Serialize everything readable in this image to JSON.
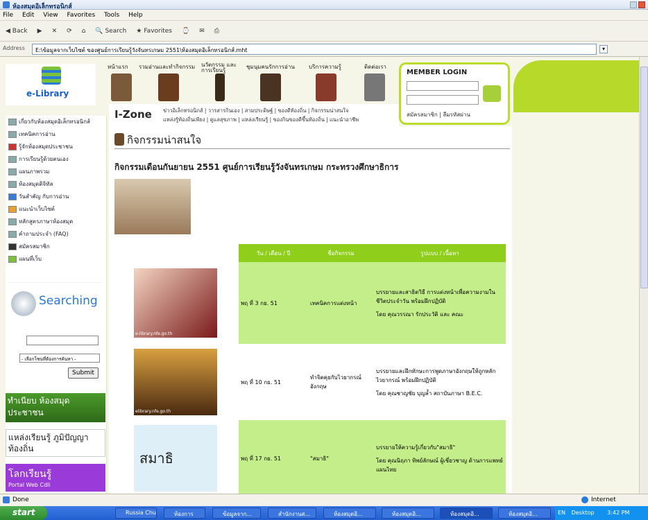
{
  "window": {
    "title": "ห้องสมุดอิเล็กทรอนิกส์"
  },
  "menu": [
    "File",
    "Edit",
    "View",
    "Favorites",
    "Tools",
    "Help"
  ],
  "toolbar": {
    "back": "Back",
    "search": "Search",
    "favorites": "Favorites"
  },
  "address": {
    "label": "Address",
    "value": "E:\\ข้อมูลจากเว็บไซต์ ของศูนย์การเรียนรู้วังจันทรเกษม 2551\\ห้องสมุดอิเล็กทรอนิกส์.mht"
  },
  "logo": {
    "text": "e-Library"
  },
  "nav": [
    "หน้าแรก",
    "รวมอ่านและทำกิจกรรม",
    "นวัตกรรม และการเรียนรู้",
    "ชุมนุมคนรักการอ่าน",
    "บริการความรู้",
    "ติดต่อเรา"
  ],
  "login": {
    "title": "MEMBER LOGIN",
    "links": "สมัครสมาชิก | ลืมรหัสผ่าน"
  },
  "izone": {
    "title": "I-Zone",
    "line1": "ข่าวอิเล็กทรอนิกส์ | วารสารกินเอง | สามประดิษฐ์ | ของดีท้องถิ่น | กิจกรรมน่าสนใจ",
    "line2": "แหล่งรู้ท้องถิ่นเพียง | ดูแลสุขภาพ | แหล่งเรียนรู้ | ของกินของดีขึ้นท้องถิ่น | แนะนำอาชีพ"
  },
  "sidebar": {
    "items": [
      "เกี่ยวกับห้องสมุดอิเล็กทรอนิกส์",
      "เทคนิคการอ่าน",
      "รู้จักห้องสมุดประชาชน",
      "การเรียนรู้ด้วยตนเอง",
      "แผนภาพรวม",
      "ห้องสมุดดิจิทัล",
      "วันสำคัญ กับการอ่าน",
      "แนะนำเว็บไซต์",
      "หลักสูตรภาษาห้องสมุด",
      "คำถามประจำ (FAQ)",
      "สมัครสมาชิก",
      "แผนที่เว็บ"
    ],
    "search_title": "Searching",
    "select_value": "- เลือกโซนที่ต้องการค้นหา -",
    "submit": "Submit",
    "banner1": "ทำเนียบ ห้องสมุดประชาชน",
    "banner2": "แหล่งเรียนรู้ ภูมิปัญญาท้องถิ่น",
    "banner3": "โลกเรียนรู้",
    "banner3_sub": "Portal Web Cdli"
  },
  "main": {
    "section": "กิจกรรมน่าสนใจ",
    "heading": "กิจกรรมเดือนกันยายน 2551 ศูนย์การเรียนรู้วังจันทรเกษม กระทรวงศึกษาธิการ",
    "columns": [
      "วัน / เดือน / ปี",
      "ชื่อกิจกรรม",
      "รูปแบบ / เนื้อหา"
    ],
    "rows": [
      {
        "date": "พฤ ที่ 3 กย. 51",
        "name": "เทคนิคการแต่งหน้า",
        "content": "บรรยายและสาธิตวิธี การแต่งหน้าเพื่อความงามในชีวิตประจำวัน พร้อมฝึกปฏิบัติ",
        "by": "โดย คุณวรรณา รักประวัติ และ คณะ",
        "img_caption": "e-library.nfe.go.th"
      },
      {
        "date": "พฤ ที่ 10 กย. 51",
        "name": "ทำจิตคุยกับไวยากรณ์อังกฤษ",
        "content": "บรรยายและฝึกทักษะการพูดภาษาอังกฤษให้ถูกหลักไวยากรณ์ พร้อมฝึกปฏิบัติ",
        "by": "โดย คุณชาญชัย บุญล้ำ สถาบันภาษา B.E.C.",
        "img_caption": "elibrary.nfe.go.th"
      },
      {
        "date": "พฤ ที่ 17 กย. 51",
        "name": "\"สมาธิ\"",
        "content": "บรรยายให้ความรู้เกี่ยวกับ\"สมาธิ\"",
        "by": "โดย คุณนิฤภา ทิพย์ลักษณ์ ผู้เชี่ยวชาญ ด้านการแพทย์แผนไทย",
        "img_caption": "สมาธิ"
      }
    ]
  },
  "status": {
    "left": "Done",
    "zone": "Internet"
  },
  "taskbar": {
    "start": "start",
    "tasks": [
      "Russia Chu...",
      "ห้องการ",
      "ข้อมูลจาก...",
      "สำนักงานส...",
      "ห้องสมุดอิ...",
      "ห้องสมุดอิ...",
      "ห้องสมุดอิ...",
      "ห้องสมุดอิ..."
    ],
    "lang": "EN",
    "desktop": "Desktop",
    "time": "3:42 PM"
  }
}
